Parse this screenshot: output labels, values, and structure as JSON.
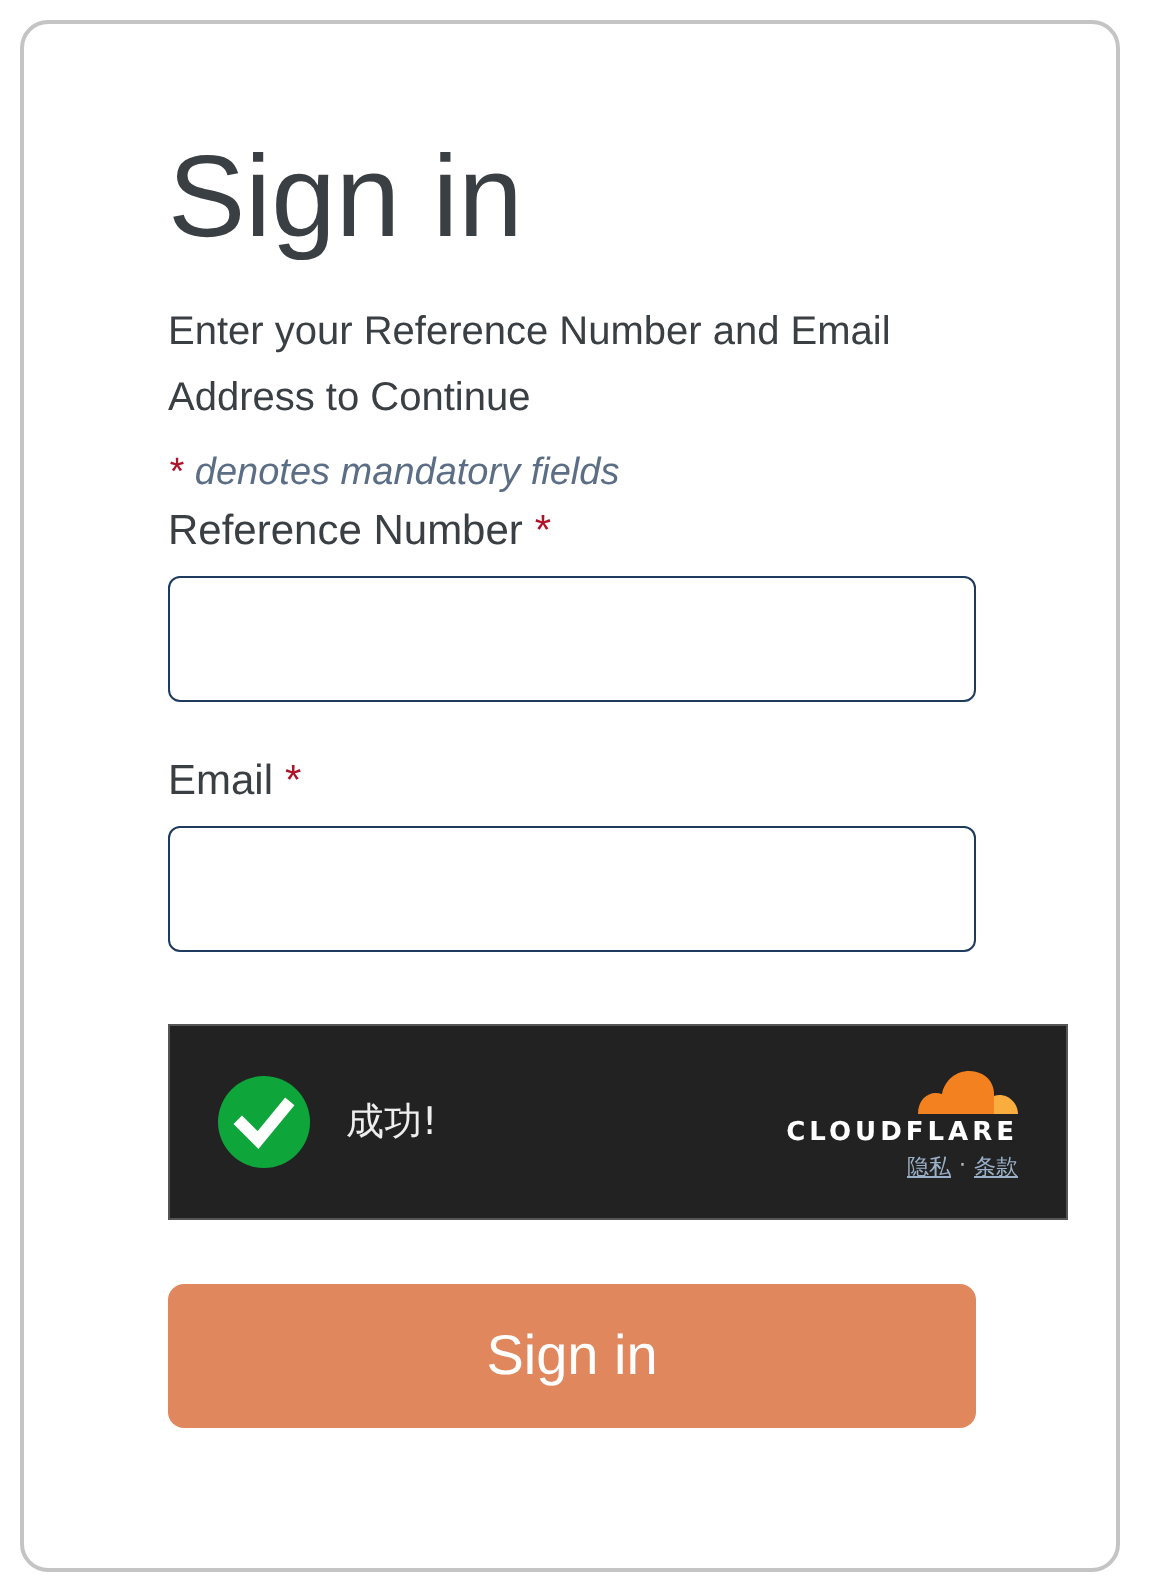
{
  "title": "Sign in",
  "intro": "Enter your Reference Number and Email Address to Continue",
  "note": {
    "mark": "*",
    "text": "denotes mandatory fields"
  },
  "fields": [
    {
      "label": "Reference Number",
      "required_mark": "*"
    },
    {
      "label": "Email",
      "required_mark": "*"
    }
  ],
  "captcha": {
    "status": "成功!",
    "logo": "CLOUDFLARE",
    "links": [
      "隐私",
      "条款"
    ],
    "separator": "·"
  },
  "submit": "Sign in"
}
